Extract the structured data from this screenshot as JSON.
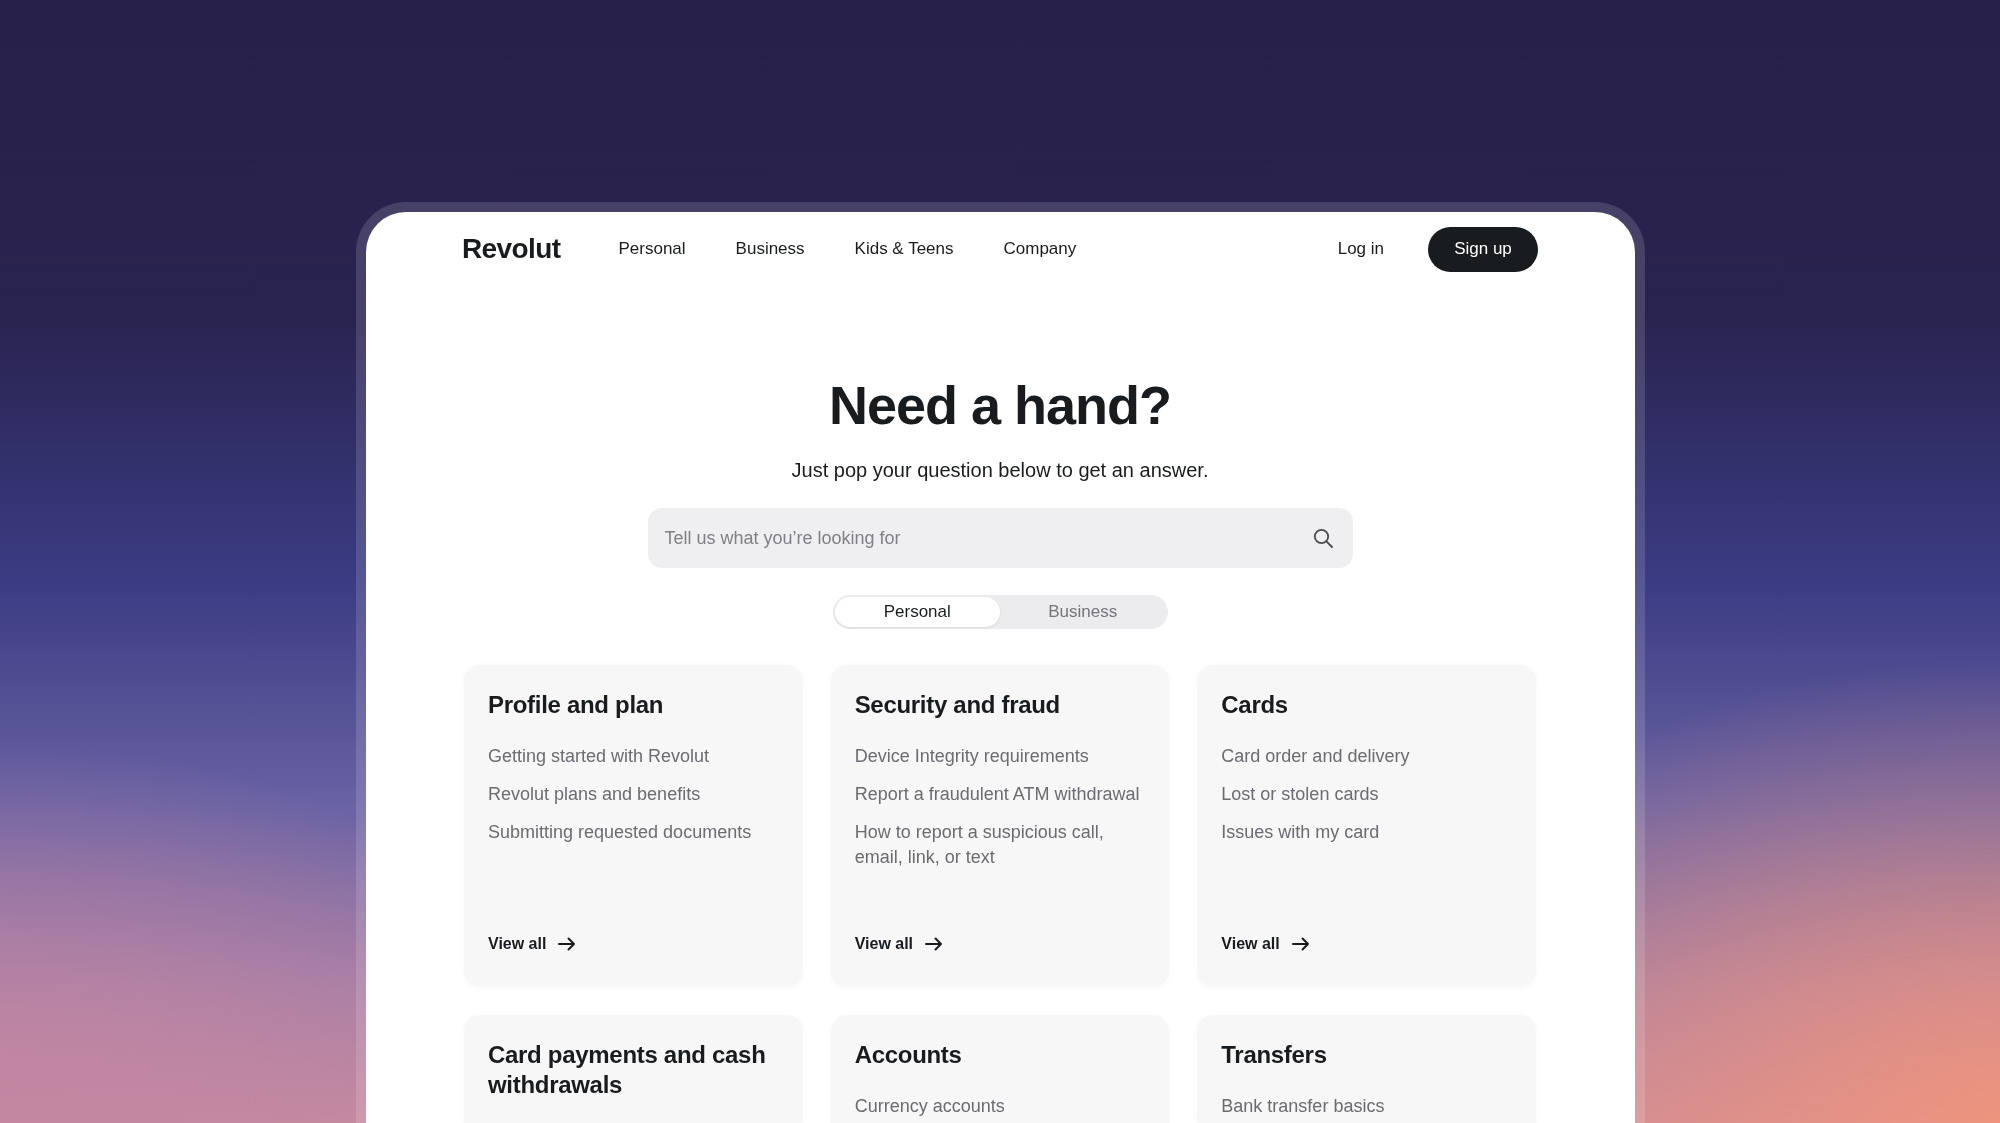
{
  "header": {
    "logo": "Revolut",
    "nav": [
      "Personal",
      "Business",
      "Kids & Teens",
      "Company"
    ],
    "login": "Log in",
    "signup": "Sign up"
  },
  "hero": {
    "title": "Need a hand?",
    "subtitle": "Just pop your question below to get an answer.",
    "search": {
      "placeholder": "Tell us what you’re looking for"
    },
    "segments": [
      {
        "label": "Personal",
        "selected": true
      },
      {
        "label": "Business",
        "selected": false
      }
    ]
  },
  "categories": [
    {
      "title": "Profile and plan",
      "links": [
        "Getting started with Revolut",
        "Revolut plans and benefits",
        "Submitting requested documents"
      ],
      "view_all": "View all"
    },
    {
      "title": "Security and fraud",
      "links": [
        "Device Integrity requirements",
        "Report a fraudulent ATM withdrawal",
        "How to report a suspicious call, email, link, or text"
      ],
      "view_all": "View all"
    },
    {
      "title": "Cards",
      "links": [
        "Card order and delivery",
        "Lost or stolen cards",
        "Issues with my card"
      ],
      "view_all": "View all"
    },
    {
      "title": "Card payments and cash withdrawals"
    },
    {
      "title": "Accounts",
      "links": [
        "Currency accounts"
      ]
    },
    {
      "title": "Transfers",
      "links": [
        "Bank transfer basics"
      ]
    }
  ]
}
